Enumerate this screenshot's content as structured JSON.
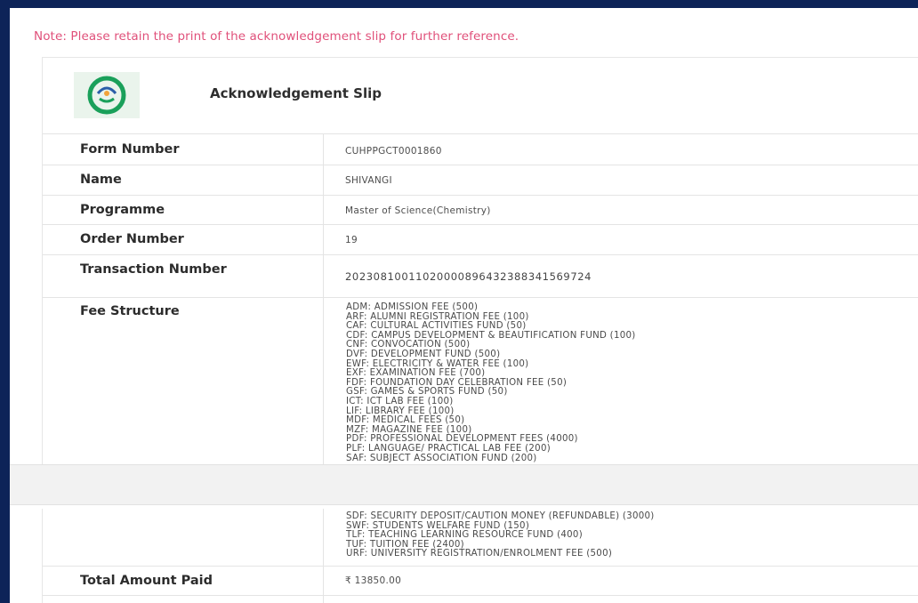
{
  "note": "Note: Please retain the print of the acknowledgement slip for further reference.",
  "slip_title": "Acknowledgement Slip",
  "logo_icon": "university-logo-icon",
  "colors": {
    "note": "#e0507a",
    "frame": "#0d2358",
    "logo_green": "#1aa05a"
  },
  "rows": [
    {
      "label": "Form Number",
      "value": "CUHPPGCT0001860"
    },
    {
      "label": "Name",
      "value": "SHIVANGI"
    },
    {
      "label": "Programme",
      "value": "Master of Science(Chemistry)"
    },
    {
      "label": "Order Number",
      "value": "19"
    },
    {
      "label": "Transaction Number",
      "value": "2023081001102000089643238834156972​4"
    }
  ],
  "fee_label": "Fee Structure",
  "fees": [
    "ADM: ADMISSION FEE (500)",
    "ARF: ALUMNI REGISTRATION FEE (100)",
    "CAF: CULTURAL ACTIVITIES FUND (50)",
    "CDF: CAMPUS DEVELOPMENT & BEAUTIFICATION FUND (100)",
    "CNF: CONVOCATION (500)",
    "DVF: DEVELOPMENT FUND (500)",
    "EWF: ELECTRICITY & WATER FEE (100)",
    "EXF: EXAMINATION FEE (700)",
    "FDF: FOUNDATION DAY CELEBRATION FEE (50)",
    "GSF: GAMES & SPORTS FUND (50)",
    "ICT: ICT LAB FEE (100)",
    "LIF: LIBRARY FEE (100)",
    "MDF: MEDICAL FEES (50)",
    "MZF: MAGAZINE FEE (100)",
    "PDF: PROFESSIONAL DEVELOPMENT FEES (4000)",
    "PLF: LANGUAGE/ PRACTICAL LAB FEE (200)",
    "SAF: SUBJECT ASSOCIATION FUND (200)"
  ],
  "fees_continued": [
    "SDF: SECURITY DEPOSIT/CAUTION MONEY (REFUNDABLE) (3000)",
    "SWF: STUDENTS WELFARE FUND (150)",
    "TLF: TEACHING LEARNING RESOURCE FUND (400)",
    "TUF: TUITION FEE (2400)",
    "URF: UNIVERSITY REGISTRATION/ENROLMENT FEE (500)"
  ],
  "total_label": "Total Amount Paid",
  "total_value": "₹ 13850.00"
}
